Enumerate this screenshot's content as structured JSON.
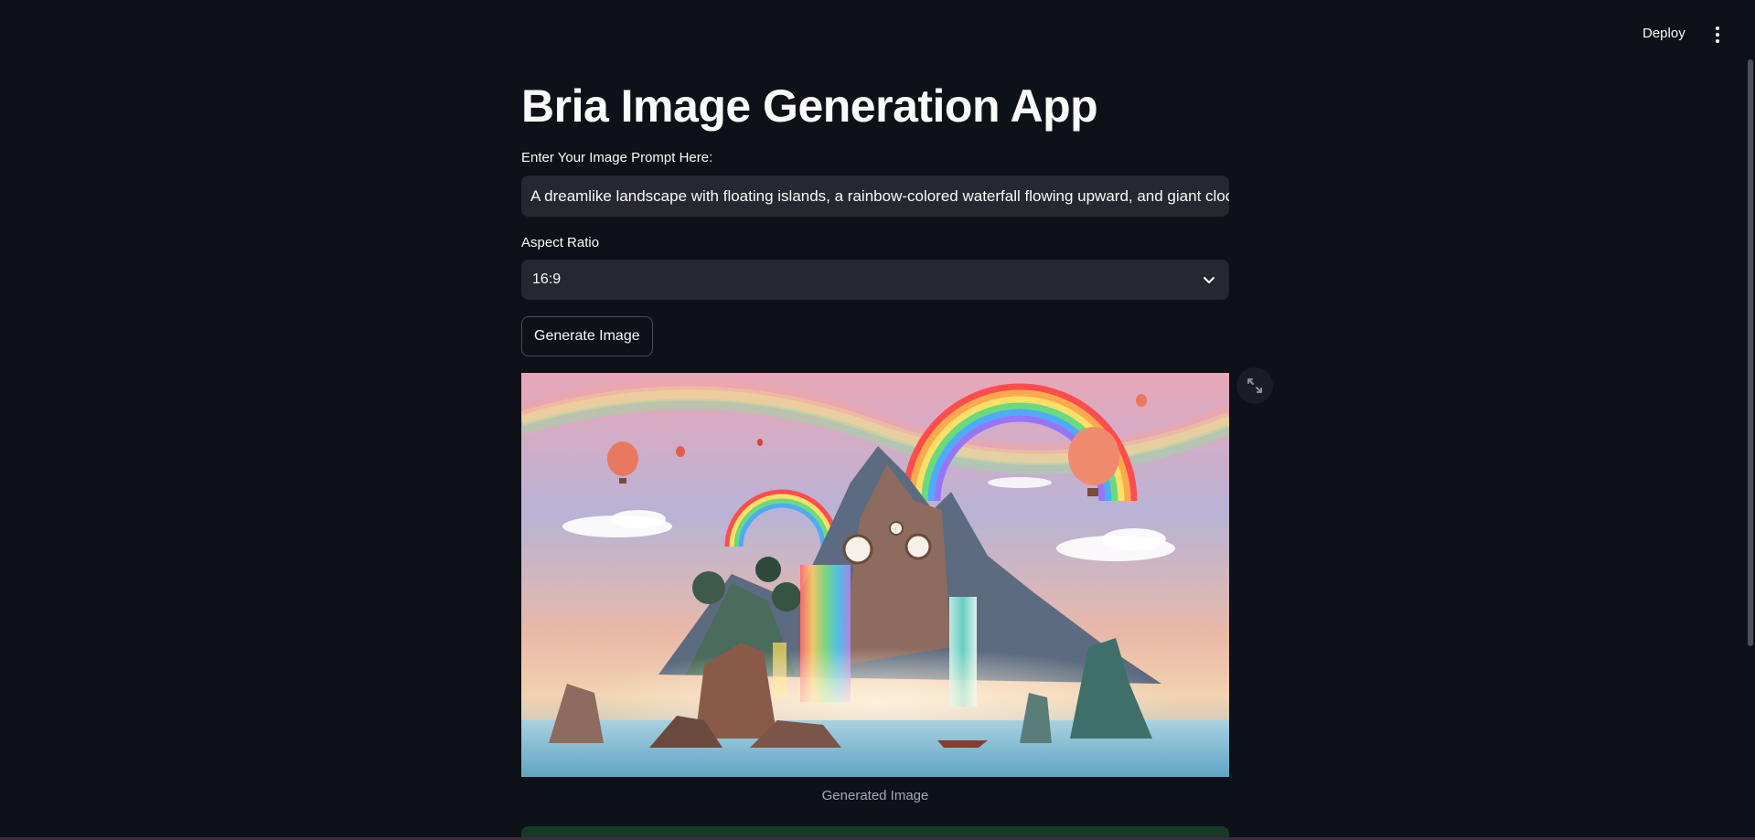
{
  "header": {
    "deploy_label": "Deploy",
    "menu_icon": "kebab-menu-icon"
  },
  "main": {
    "title": "Bria Image Generation App",
    "prompt": {
      "label": "Enter Your Image Prompt Here:",
      "value": "A dreamlike landscape with floating islands, a rainbow-colored waterfall flowing upward, and giant cloc"
    },
    "aspect_ratio": {
      "label": "Aspect Ratio",
      "selected": "16:9",
      "icon": "chevron-down-icon"
    },
    "generate_button_label": "Generate Image",
    "image": {
      "caption": "Generated Image",
      "fullscreen_icon": "expand-icon"
    }
  },
  "colors": {
    "background": "#0e1117",
    "input_bg": "#262730",
    "text": "#fafafa",
    "caption": "#a3a8b8",
    "success": "#173928"
  }
}
